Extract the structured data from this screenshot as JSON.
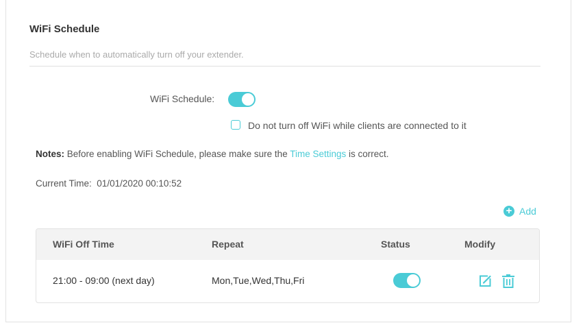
{
  "section": {
    "title": "WiFi Schedule",
    "subtitle": "Schedule when to automatically turn off your extender."
  },
  "schedule": {
    "label": "WiFi Schedule:",
    "enabled": true,
    "clients_checkbox_label": "Do not turn off WiFi while clients are connected to it",
    "clients_checkbox_checked": false
  },
  "notes": {
    "prefix": "Notes:",
    "text_before": " Before enabling WiFi Schedule, please make sure the ",
    "link": "Time Settings",
    "text_after": " is correct."
  },
  "current_time": {
    "label": "Current Time:",
    "value": "01/01/2020 00:10:52"
  },
  "add_button": {
    "label": "Add",
    "icon": "plus-circle-icon"
  },
  "table": {
    "columns": [
      "WiFi Off Time",
      "Repeat",
      "Status",
      "Modify"
    ],
    "rows": [
      {
        "off_time": "21:00 - 09:00 (next day)",
        "repeat": "Mon,Tue,Wed,Thu,Fri",
        "status_enabled": true
      }
    ]
  },
  "colors": {
    "accent": "#4acbd6",
    "header_bg": "#f3f3f3",
    "border": "#e2e2e2"
  }
}
